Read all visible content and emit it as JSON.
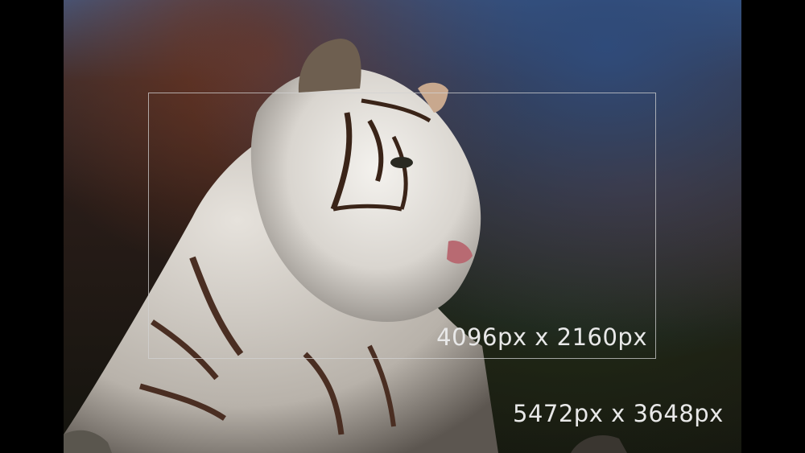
{
  "image": {
    "subject": "white-tiger-photo",
    "crop_label": "4096px x 2160px",
    "full_label": "5472px x 3648px"
  },
  "colors": {
    "frame_border": "#d2d2d2",
    "label_text": "#e8e8e8",
    "letterbox": "#000000"
  }
}
